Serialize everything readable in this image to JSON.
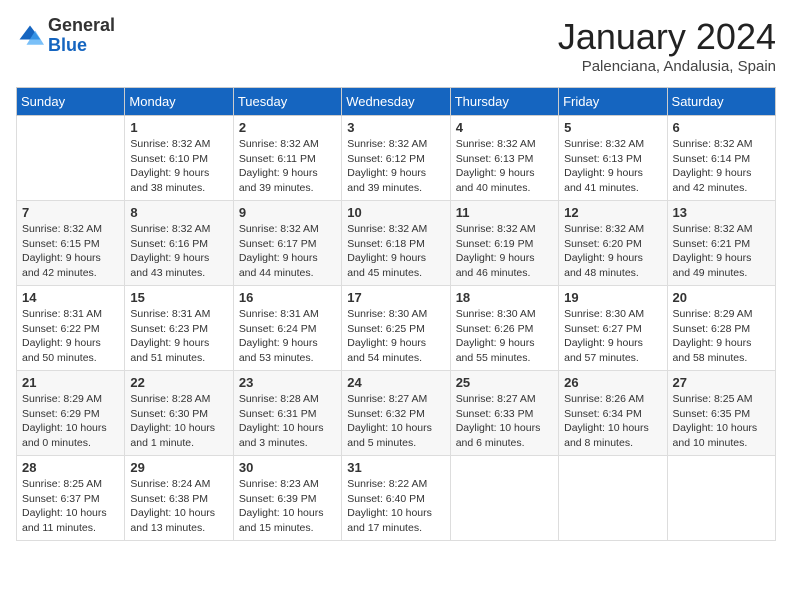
{
  "header": {
    "logo_general": "General",
    "logo_blue": "Blue",
    "month_title": "January 2024",
    "location": "Palenciana, Andalusia, Spain"
  },
  "weekdays": [
    "Sunday",
    "Monday",
    "Tuesday",
    "Wednesday",
    "Thursday",
    "Friday",
    "Saturday"
  ],
  "weeks": [
    [
      {
        "day": "",
        "sunrise": "",
        "sunset": "",
        "daylight": ""
      },
      {
        "day": "1",
        "sunrise": "Sunrise: 8:32 AM",
        "sunset": "Sunset: 6:10 PM",
        "daylight": "Daylight: 9 hours and 38 minutes."
      },
      {
        "day": "2",
        "sunrise": "Sunrise: 8:32 AM",
        "sunset": "Sunset: 6:11 PM",
        "daylight": "Daylight: 9 hours and 39 minutes."
      },
      {
        "day": "3",
        "sunrise": "Sunrise: 8:32 AM",
        "sunset": "Sunset: 6:12 PM",
        "daylight": "Daylight: 9 hours and 39 minutes."
      },
      {
        "day": "4",
        "sunrise": "Sunrise: 8:32 AM",
        "sunset": "Sunset: 6:13 PM",
        "daylight": "Daylight: 9 hours and 40 minutes."
      },
      {
        "day": "5",
        "sunrise": "Sunrise: 8:32 AM",
        "sunset": "Sunset: 6:13 PM",
        "daylight": "Daylight: 9 hours and 41 minutes."
      },
      {
        "day": "6",
        "sunrise": "Sunrise: 8:32 AM",
        "sunset": "Sunset: 6:14 PM",
        "daylight": "Daylight: 9 hours and 42 minutes."
      }
    ],
    [
      {
        "day": "7",
        "sunrise": "Sunrise: 8:32 AM",
        "sunset": "Sunset: 6:15 PM",
        "daylight": "Daylight: 9 hours and 42 minutes."
      },
      {
        "day": "8",
        "sunrise": "Sunrise: 8:32 AM",
        "sunset": "Sunset: 6:16 PM",
        "daylight": "Daylight: 9 hours and 43 minutes."
      },
      {
        "day": "9",
        "sunrise": "Sunrise: 8:32 AM",
        "sunset": "Sunset: 6:17 PM",
        "daylight": "Daylight: 9 hours and 44 minutes."
      },
      {
        "day": "10",
        "sunrise": "Sunrise: 8:32 AM",
        "sunset": "Sunset: 6:18 PM",
        "daylight": "Daylight: 9 hours and 45 minutes."
      },
      {
        "day": "11",
        "sunrise": "Sunrise: 8:32 AM",
        "sunset": "Sunset: 6:19 PM",
        "daylight": "Daylight: 9 hours and 46 minutes."
      },
      {
        "day": "12",
        "sunrise": "Sunrise: 8:32 AM",
        "sunset": "Sunset: 6:20 PM",
        "daylight": "Daylight: 9 hours and 48 minutes."
      },
      {
        "day": "13",
        "sunrise": "Sunrise: 8:32 AM",
        "sunset": "Sunset: 6:21 PM",
        "daylight": "Daylight: 9 hours and 49 minutes."
      }
    ],
    [
      {
        "day": "14",
        "sunrise": "Sunrise: 8:31 AM",
        "sunset": "Sunset: 6:22 PM",
        "daylight": "Daylight: 9 hours and 50 minutes."
      },
      {
        "day": "15",
        "sunrise": "Sunrise: 8:31 AM",
        "sunset": "Sunset: 6:23 PM",
        "daylight": "Daylight: 9 hours and 51 minutes."
      },
      {
        "day": "16",
        "sunrise": "Sunrise: 8:31 AM",
        "sunset": "Sunset: 6:24 PM",
        "daylight": "Daylight: 9 hours and 53 minutes."
      },
      {
        "day": "17",
        "sunrise": "Sunrise: 8:30 AM",
        "sunset": "Sunset: 6:25 PM",
        "daylight": "Daylight: 9 hours and 54 minutes."
      },
      {
        "day": "18",
        "sunrise": "Sunrise: 8:30 AM",
        "sunset": "Sunset: 6:26 PM",
        "daylight": "Daylight: 9 hours and 55 minutes."
      },
      {
        "day": "19",
        "sunrise": "Sunrise: 8:30 AM",
        "sunset": "Sunset: 6:27 PM",
        "daylight": "Daylight: 9 hours and 57 minutes."
      },
      {
        "day": "20",
        "sunrise": "Sunrise: 8:29 AM",
        "sunset": "Sunset: 6:28 PM",
        "daylight": "Daylight: 9 hours and 58 minutes."
      }
    ],
    [
      {
        "day": "21",
        "sunrise": "Sunrise: 8:29 AM",
        "sunset": "Sunset: 6:29 PM",
        "daylight": "Daylight: 10 hours and 0 minutes."
      },
      {
        "day": "22",
        "sunrise": "Sunrise: 8:28 AM",
        "sunset": "Sunset: 6:30 PM",
        "daylight": "Daylight: 10 hours and 1 minute."
      },
      {
        "day": "23",
        "sunrise": "Sunrise: 8:28 AM",
        "sunset": "Sunset: 6:31 PM",
        "daylight": "Daylight: 10 hours and 3 minutes."
      },
      {
        "day": "24",
        "sunrise": "Sunrise: 8:27 AM",
        "sunset": "Sunset: 6:32 PM",
        "daylight": "Daylight: 10 hours and 5 minutes."
      },
      {
        "day": "25",
        "sunrise": "Sunrise: 8:27 AM",
        "sunset": "Sunset: 6:33 PM",
        "daylight": "Daylight: 10 hours and 6 minutes."
      },
      {
        "day": "26",
        "sunrise": "Sunrise: 8:26 AM",
        "sunset": "Sunset: 6:34 PM",
        "daylight": "Daylight: 10 hours and 8 minutes."
      },
      {
        "day": "27",
        "sunrise": "Sunrise: 8:25 AM",
        "sunset": "Sunset: 6:35 PM",
        "daylight": "Daylight: 10 hours and 10 minutes."
      }
    ],
    [
      {
        "day": "28",
        "sunrise": "Sunrise: 8:25 AM",
        "sunset": "Sunset: 6:37 PM",
        "daylight": "Daylight: 10 hours and 11 minutes."
      },
      {
        "day": "29",
        "sunrise": "Sunrise: 8:24 AM",
        "sunset": "Sunset: 6:38 PM",
        "daylight": "Daylight: 10 hours and 13 minutes."
      },
      {
        "day": "30",
        "sunrise": "Sunrise: 8:23 AM",
        "sunset": "Sunset: 6:39 PM",
        "daylight": "Daylight: 10 hours and 15 minutes."
      },
      {
        "day": "31",
        "sunrise": "Sunrise: 8:22 AM",
        "sunset": "Sunset: 6:40 PM",
        "daylight": "Daylight: 10 hours and 17 minutes."
      },
      {
        "day": "",
        "sunrise": "",
        "sunset": "",
        "daylight": ""
      },
      {
        "day": "",
        "sunrise": "",
        "sunset": "",
        "daylight": ""
      },
      {
        "day": "",
        "sunrise": "",
        "sunset": "",
        "daylight": ""
      }
    ]
  ]
}
